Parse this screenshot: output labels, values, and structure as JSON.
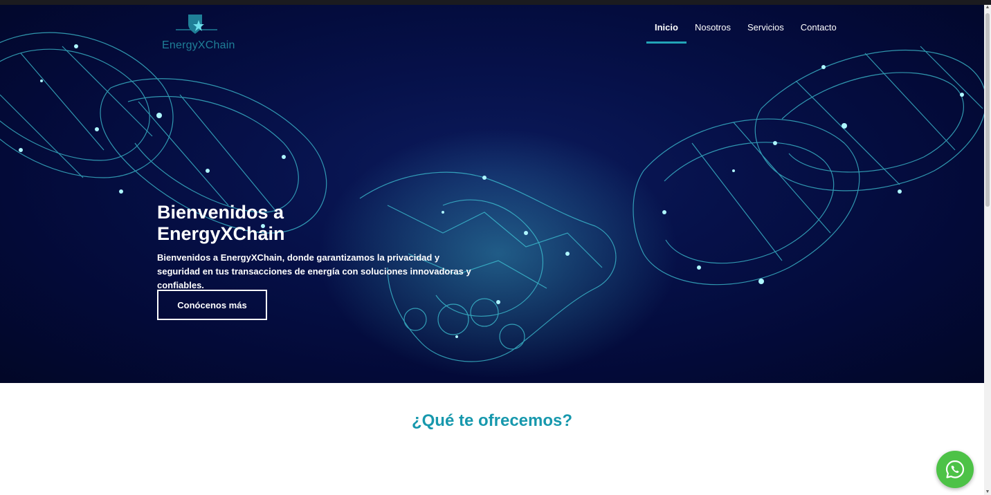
{
  "brand": {
    "name": "EnergyXChain"
  },
  "nav": {
    "items": [
      {
        "label": "Inicio",
        "active": true
      },
      {
        "label": "Nosotros",
        "active": false
      },
      {
        "label": "Servicios",
        "active": false
      },
      {
        "label": "Contacto",
        "active": false
      }
    ]
  },
  "hero": {
    "title": "Bienvenidos a EnergyXChain",
    "description": "Bienvenidos a EnergyXChain, donde garantizamos la privacidad y seguridad en tus transacciones de energía con soluciones innovadoras y confiables.",
    "button_label": "Conócenos más"
  },
  "section": {
    "title": "¿Qué te ofrecemos?"
  },
  "floating": {
    "icon": "whatsapp-icon"
  },
  "colors": {
    "accent": "#1798ad",
    "nav_underline": "#23a5b7",
    "hero_bg": "#030a38",
    "whatsapp": "#4dc247"
  }
}
